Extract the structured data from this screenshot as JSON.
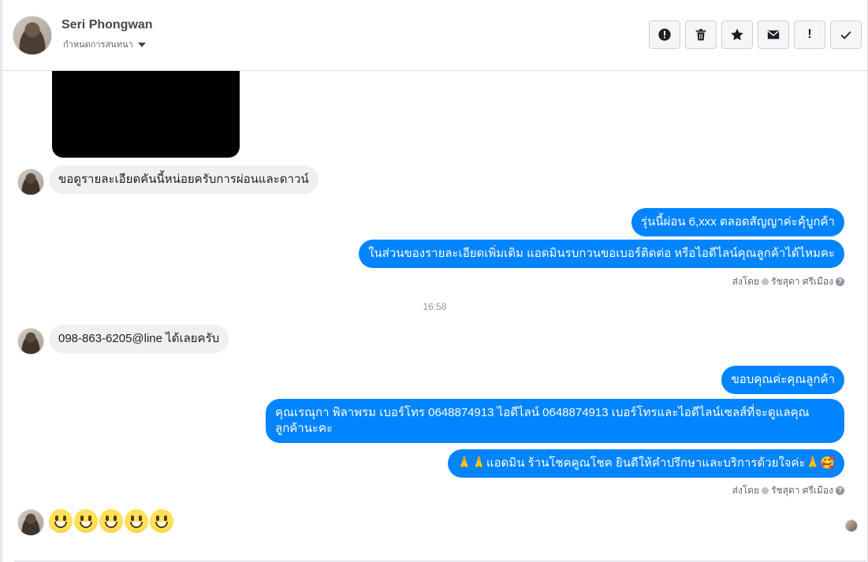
{
  "header": {
    "contact_name": "Seri Phongwan",
    "assign_label": "กำหนดการสนทนา",
    "actions": [
      {
        "name": "spam-icon",
        "label": ""
      },
      {
        "name": "trash-icon",
        "label": ""
      },
      {
        "name": "star-icon",
        "label": ""
      },
      {
        "name": "envelope-icon",
        "label": ""
      },
      {
        "name": "important-icon",
        "label": "!"
      },
      {
        "name": "checkmark-icon",
        "label": ""
      }
    ]
  },
  "messages": {
    "incoming_1": "ขอดูรายละเอียดคันนี้หน่อยครับการผ่อนและดาวน์",
    "outgoing_1": "รุ่นนี้ผ่อน  6,xxx  ตลอดสัญญาค่ะคุ้บูกค้า",
    "outgoing_2": "ในส่วนของรายละเอียดเพิ่มเติม แอดมินรบกวนขอเบอร์ติดต่อ หรือไอดีไลน์คุณลูกค้าได้ไหมคะ",
    "sent_by_1": {
      "prefix": "ส่งโดย",
      "name": "รัชสุดา ศรีเมือง"
    },
    "time_divider": "16:58",
    "incoming_2": "098-863-6205@line ได้เลยครับ",
    "outgoing_3": "ขอบคุณค่ะคุณลูกค้า",
    "outgoing_4": "คุณเรณุกา พิลาพรม       เบอร์โทร 0648874913  ไอดีไลน์ 0648874913   เบอร์โทรและไอดีไลน์เซลส์ที่จะดูแลคุณลูกค้านะคะ",
    "outgoing_5": "🙏🙏แอดมิน ร้านโชคคูณโชค ยินดีให้คำปรึกษาและบริการด้วยใจค่ะ🙏🥰",
    "sent_by_2": {
      "prefix": "ส่งโดย",
      "name": "รัชสุดา ศรีเมือง"
    },
    "incoming_3_emoji": "😀😀😀😀😀"
  },
  "colors": {
    "outgoing_bubble": "#0084ff",
    "incoming_bubble": "#f0f0f0"
  }
}
